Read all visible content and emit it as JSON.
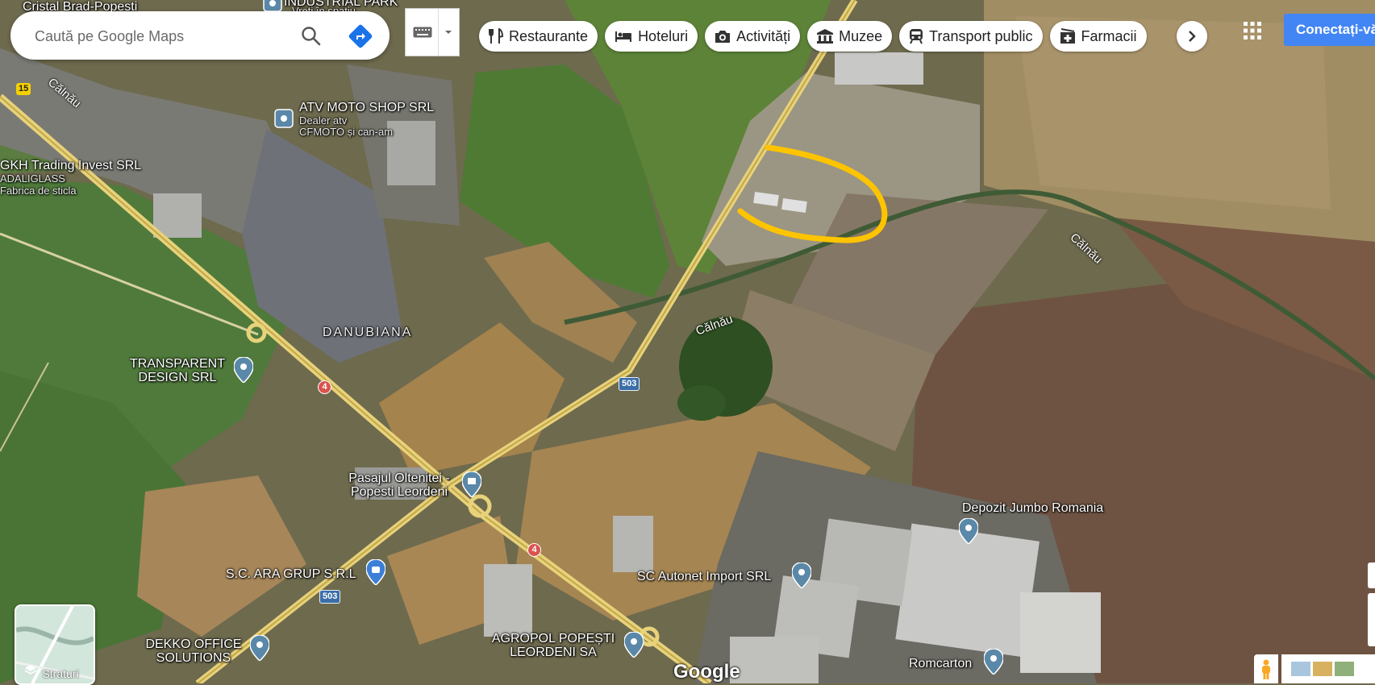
{
  "search": {
    "placeholder": "Caută pe Google Maps"
  },
  "chips": [
    {
      "label": "Restaurante",
      "icon": "fork-knife-icon"
    },
    {
      "label": "Hoteluri",
      "icon": "bed-icon"
    },
    {
      "label": "Activități",
      "icon": "camera-icon"
    },
    {
      "label": "Muzee",
      "icon": "museum-icon"
    },
    {
      "label": "Transport public",
      "icon": "train-icon"
    },
    {
      "label": "Farmacii",
      "icon": "pharmacy-icon"
    }
  ],
  "signin_label": "Conectați-vă",
  "layers_label": "Straturi",
  "google_logo": "Google",
  "places": {
    "cristal": "Cristal Brad-Popesti",
    "industrial_park": "INDUSTRIAL PARK",
    "industrial_park_sub": "Vreți în spațiu",
    "atv_name": "ATV MOTO SHOP SRL",
    "atv_sub1": "Dealer atv",
    "atv_sub2": "CFMOTO și can-am",
    "gkh_name": "GKH Trading Invest SRL",
    "gkh_sub1": "ADALIGLASS",
    "gkh_sub2": "Fabrica de sticla",
    "danubiana": "DANUBIANA",
    "transparent1": "TRANSPARENT",
    "transparent2": "DESIGN SRL",
    "pasaj1": "Pasajul Oltenitei -",
    "pasaj2": "Popesti Leordeni",
    "ara": "S.C. ARA GRUP S.R.L",
    "dekko1": "DEKKO OFFICE",
    "dekko2": "SOLUTIONS",
    "agropol1": "AGROPOL POPEȘTI",
    "agropol2": "LEORDENI SA",
    "autonet": "SC Autonet Import SRL",
    "jumbo": "Depozit Jumbo Romania",
    "romcarton": "Romcarton"
  },
  "rivers": {
    "calnau": "Călnău"
  },
  "roads": {
    "r15": "15",
    "r4": "4",
    "r503": "503"
  },
  "colors": {
    "highlight": "#ffc400",
    "road": "#e8d27a",
    "chip_bg": "#ffffff",
    "signin": "#4285f4",
    "pin": "#5a88a8"
  }
}
